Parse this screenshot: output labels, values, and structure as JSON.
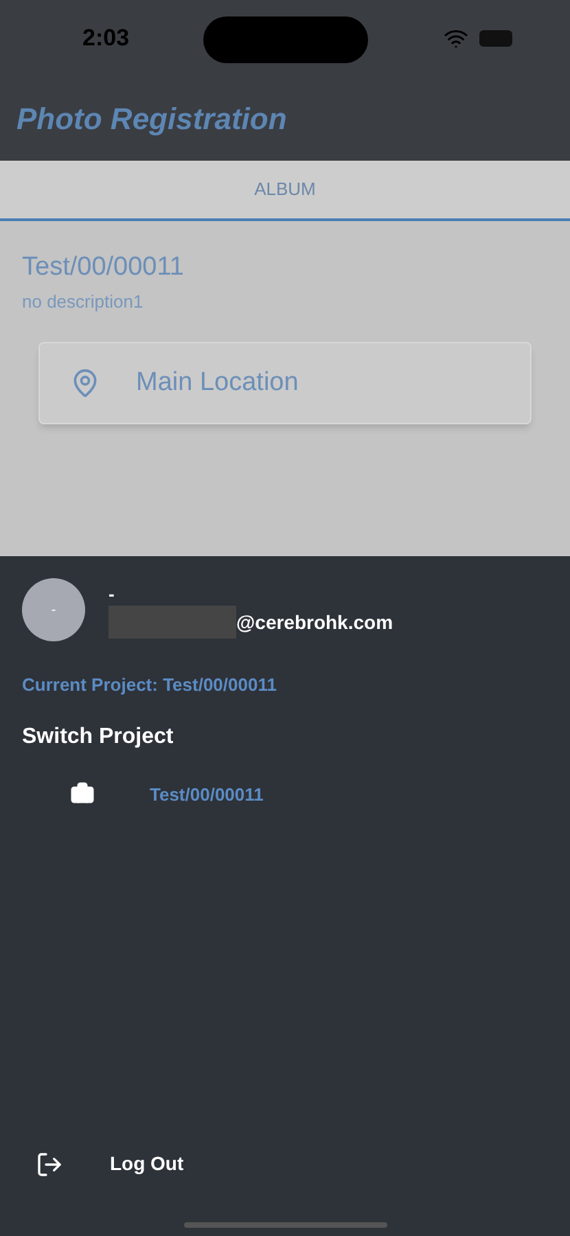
{
  "status_bar": {
    "time": "2:03"
  },
  "header": {
    "title": "Photo Registration"
  },
  "tabs": [
    {
      "label": "ALBUM",
      "selected": true
    }
  ],
  "project": {
    "name": "Test/00/00011",
    "description": "no description1"
  },
  "location_button": {
    "label": "Main Location"
  },
  "drawer": {
    "avatar_initial": "-",
    "user_name": "-",
    "email": "@cerebrohk.com",
    "email_redacted": true,
    "current_project": "Current Project: Test/00/00011",
    "switch_heading": "Switch Project",
    "projects": [
      {
        "name": "Test/00/00011"
      }
    ],
    "logout": "Log Out"
  }
}
